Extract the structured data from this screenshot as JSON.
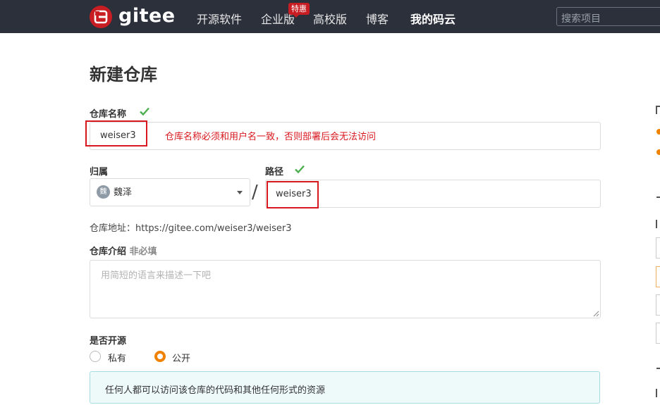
{
  "nav": {
    "logo_text": "gitee",
    "items": [
      "开源软件",
      "企业版",
      "高校版",
      "博客",
      "我的码云"
    ],
    "badge": "特惠",
    "search_placeholder": "搜索项目"
  },
  "page": {
    "title": "新建仓库"
  },
  "repo_name": {
    "label": "仓库名称",
    "value": "weiser3",
    "annotation": "仓库名称必须和用户名一致，否则部署后会无法访问"
  },
  "owner": {
    "label": "归属",
    "avatar_char": "魏",
    "name": "魏泽"
  },
  "path": {
    "label": "路径",
    "separator": "/",
    "value": "weiser3"
  },
  "repo_url": {
    "text": "仓库地址：https://gitee.com/weiser3/weiser3"
  },
  "description": {
    "label": "仓库介绍",
    "optional": "非必填",
    "placeholder": "用简短的语言来描述一下吧"
  },
  "visibility": {
    "label": "是否开源",
    "options": [
      "私有",
      "公开"
    ],
    "selected": "公开",
    "info": "任何人都可以访问该仓库的代码和其他任何形式的资源"
  },
  "colors": {
    "nav_bg": "#2b303b",
    "brand_red": "#c71d23",
    "accent_orange": "#f08200",
    "check_green": "#4caf50",
    "annotation_red": "#d8171e"
  }
}
